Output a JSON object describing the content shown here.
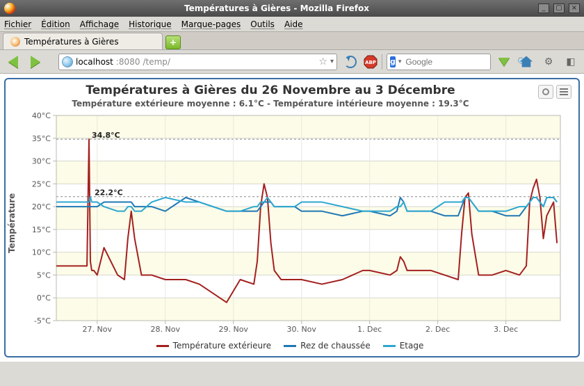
{
  "window": {
    "title": "Températures à Gières - Mozilla Firefox"
  },
  "menu": {
    "items": [
      "Fichier",
      "Édition",
      "Affichage",
      "Historique",
      "Marque-pages",
      "Outils",
      "Aide"
    ]
  },
  "tab": {
    "label": "Températures à Gières"
  },
  "url": {
    "host": "localhost",
    "port": ":8080",
    "path": "/temp/"
  },
  "search": {
    "engine": "g",
    "placeholder": "Google"
  },
  "chart": {
    "title": "Températures à Gières du 26 Novembre au 3 Décembre",
    "subtitle": "Température extérieure moyenne : 6.1°C - Température intérieure moyenne : 19.3°C",
    "ylabel": "Température",
    "legend": [
      "Température extérieure",
      "Rez de chaussée",
      "Etage"
    ],
    "annotations": [
      "34.8°C",
      "22.2°C"
    ]
  },
  "chart_data": {
    "type": "line",
    "title": "Températures à Gières du 26 Novembre au 3 Décembre",
    "subtitle": "Température extérieure moyenne : 6.1°C - Température intérieure moyenne : 19.3°C",
    "ylabel": "Température (°C)",
    "xlabel": "",
    "ylim": [
      -5,
      40
    ],
    "y_ticks": [
      -5,
      0,
      5,
      10,
      15,
      20,
      25,
      30,
      35,
      40
    ],
    "x_ticks": [
      "27. Nov",
      "28. Nov",
      "29. Nov",
      "30. Nov",
      "1. Dec",
      "2. Dec",
      "3. Dec"
    ],
    "x_unit": "days since 26 Nov 00:00 (approx)",
    "x": [
      0.4,
      0.75,
      0.85,
      0.88,
      0.9,
      0.92,
      0.95,
      1.0,
      1.1,
      1.3,
      1.4,
      1.45,
      1.5,
      1.55,
      1.65,
      1.8,
      2.0,
      2.3,
      2.5,
      2.9,
      3.1,
      3.3,
      3.35,
      3.4,
      3.45,
      3.5,
      3.55,
      3.6,
      3.7,
      3.9,
      4.0,
      4.3,
      4.6,
      4.9,
      5.0,
      5.3,
      5.4,
      5.45,
      5.5,
      5.55,
      5.7,
      5.9,
      6.1,
      6.3,
      6.35,
      6.4,
      6.45,
      6.5,
      6.6,
      6.8,
      7.0,
      7.2,
      7.3,
      7.35,
      7.4,
      7.45,
      7.5,
      7.55,
      7.6,
      7.7,
      7.75
    ],
    "series": [
      {
        "name": "Température extérieure",
        "color": "#a3201f",
        "values": [
          7,
          7,
          7,
          34.8,
          8,
          6,
          6,
          5,
          11,
          5,
          4,
          13,
          19,
          13,
          5,
          5,
          4,
          4,
          3,
          -1,
          4,
          3,
          8,
          20,
          25,
          22,
          12,
          6,
          4,
          4,
          4,
          3,
          4,
          6,
          6,
          5,
          6,
          9,
          8,
          6,
          6,
          6,
          5,
          4,
          14,
          22,
          23,
          14,
          5,
          5,
          6,
          5,
          7,
          21,
          24,
          26,
          22,
          13,
          18,
          21,
          12
        ]
      },
      {
        "name": "Rez de chaussée",
        "color": "#1f78b4",
        "values": [
          20,
          20,
          20,
          20,
          20,
          20,
          20,
          20,
          21,
          21,
          21,
          21,
          21,
          20,
          20,
          20,
          19,
          22,
          21,
          19,
          19,
          19,
          19,
          20,
          21,
          21,
          21,
          20,
          20,
          20,
          19,
          19,
          18,
          19,
          19,
          18,
          19,
          22,
          21,
          19,
          19,
          19,
          18,
          18,
          20,
          22,
          22,
          21,
          19,
          19,
          18,
          18,
          20,
          21,
          22,
          22,
          21,
          20,
          22,
          22,
          21
        ]
      },
      {
        "name": "Etage",
        "color": "#2da7cf",
        "values": [
          21,
          21,
          21,
          21,
          22.2,
          21,
          21,
          21,
          20,
          19,
          19,
          20,
          20,
          19,
          19,
          21,
          22,
          21,
          21,
          19,
          19,
          20,
          20,
          21,
          21,
          22,
          21,
          20,
          20,
          20,
          21,
          21,
          20,
          19,
          19,
          19,
          20,
          20,
          21,
          19,
          19,
          19,
          21,
          21,
          21,
          22,
          22,
          21,
          19,
          19,
          19,
          20,
          20,
          21,
          22,
          22,
          21,
          20,
          22,
          22,
          21
        ]
      }
    ],
    "annotations": [
      {
        "text": "34.8°C",
        "series": 0,
        "x": 0.88,
        "y": 34.8
      },
      {
        "text": "22.2°C",
        "series": 2,
        "x": 0.92,
        "y": 22.2
      }
    ],
    "means": {
      "exterior": 6.1,
      "interior": 19.3
    }
  }
}
